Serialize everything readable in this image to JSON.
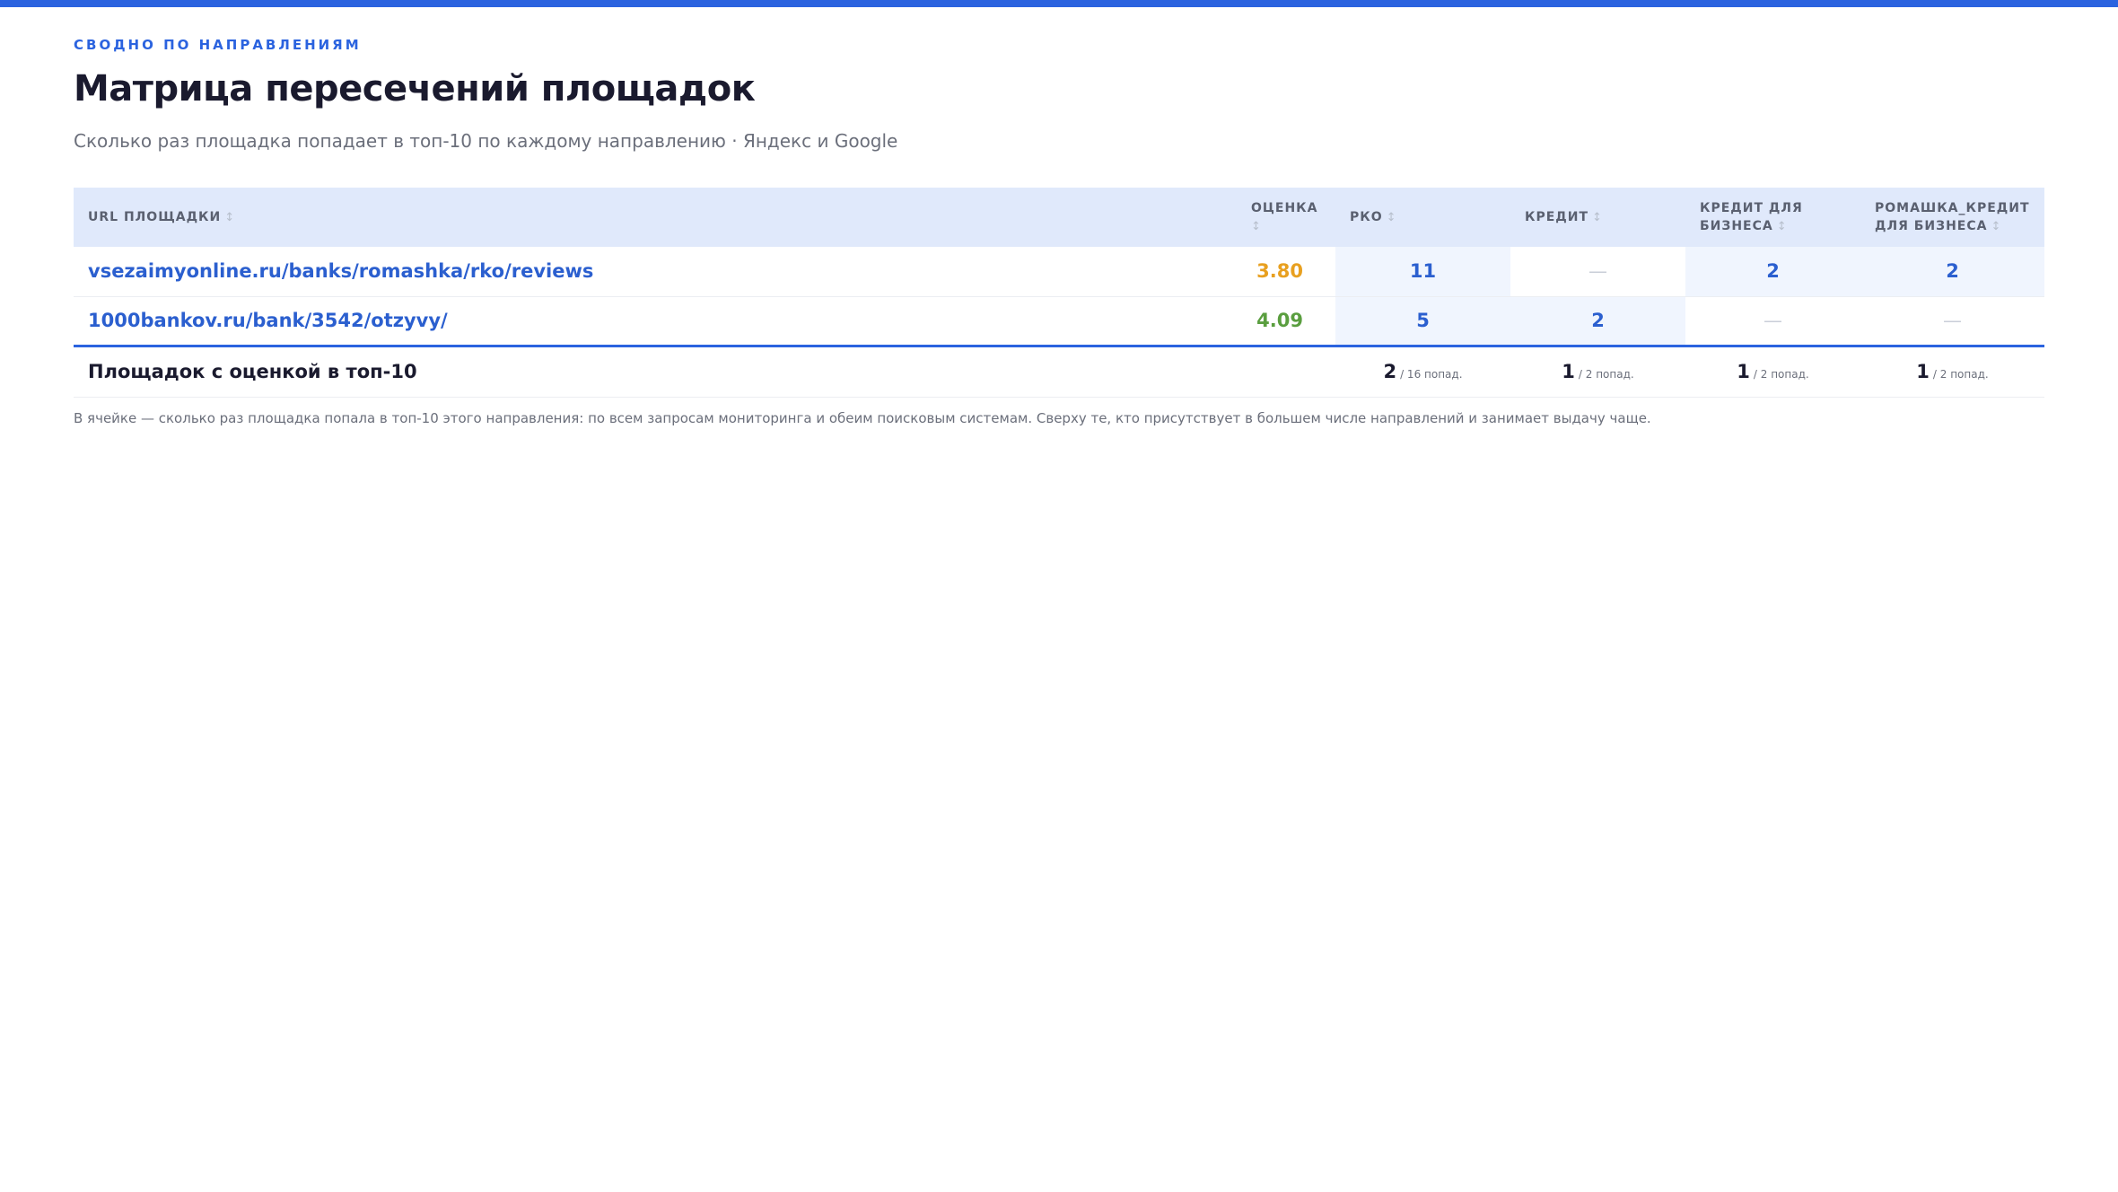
{
  "header": {
    "eyebrow": "СВОДНО ПО НАПРАВЛЕНИЯМ",
    "title": "Матрица пересечений площадок",
    "subtitle": "Сколько раз площадка попадает в топ-10 по каждому направлению · Яндекс и Google"
  },
  "colors": {
    "accent": "#2b63df",
    "link": "#2b5fcf",
    "score_mid": "#e8a020",
    "score_good": "#5a9e3f",
    "header_bg": "#e0e9fb",
    "cell_filled_bg": "#f0f5fe"
  },
  "table": {
    "columns": {
      "url": "URL ПЛОЩАДКИ",
      "score": "ОЦЕНКА",
      "rko": "РКО",
      "credit": "КРЕДИТ",
      "credit_business": "КРЕДИТ ДЛЯ БИЗНЕСА",
      "romashka_credit_business": "РОМАШКА_КРЕДИТ ДЛЯ БИЗНЕСА"
    },
    "sort_icon": "↕",
    "rows": [
      {
        "url": "vsezaimyonline.ru/banks/romashka/rko/reviews",
        "score": "3.80",
        "score_color": "#e8a020",
        "rko": "11",
        "credit": "—",
        "credit_business": "2",
        "romashka_credit_business": "2"
      },
      {
        "url": "1000bankov.ru/bank/3542/otzyvy/",
        "score": "4.09",
        "score_color": "#5a9e3f",
        "rko": "5",
        "credit": "2",
        "credit_business": "—",
        "romashka_credit_business": "—"
      }
    ],
    "footer": {
      "label": "Площадок с оценкой в топ-10",
      "rko": {
        "count": "2",
        "sub": "/ 16 попад."
      },
      "credit": {
        "count": "1",
        "sub": "/ 2 попад."
      },
      "credit_business": {
        "count": "1",
        "sub": "/ 2 попад."
      },
      "romashka_credit_business": {
        "count": "1",
        "sub": "/ 2 попад."
      }
    }
  },
  "footnote": "В ячейке — сколько раз площадка попала в топ-10 этого направления: по всем запросам мониторинга и обеим поисковым системам. Сверху те, кто присутствует в большем числе направлений и занимает выдачу чаще."
}
